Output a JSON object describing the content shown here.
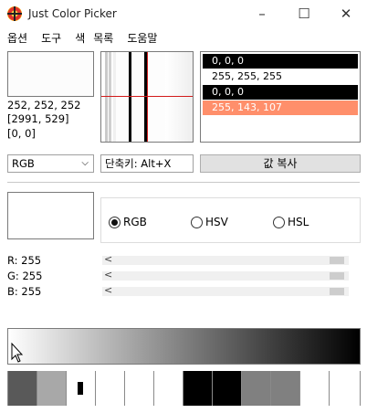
{
  "window": {
    "title": "Just Color Picker",
    "minimize": "–",
    "maximize": "☐",
    "close": "✕"
  },
  "menu": [
    "옵션",
    "도구",
    "색",
    "목록",
    "도움말"
  ],
  "info": {
    "rgb": "252, 252, 252",
    "coords": "[2991, 529]",
    "extra": "[0, 0]"
  },
  "history": [
    {
      "text": "0, 0, 0",
      "bg": "#000000",
      "fg": "#ffffff"
    },
    {
      "text": "255, 255, 255",
      "bg": "#ffffff",
      "fg": "#000000"
    },
    {
      "text": "0, 0, 0",
      "bg": "#000000",
      "fg": "#ffffff"
    },
    {
      "text": "255, 143, 107",
      "bg": "#ff8f6b",
      "fg": "#ffffff"
    }
  ],
  "format_select": "RGB",
  "hotkey": "단축키: Alt+X",
  "copy_button": "값 복사",
  "modes": [
    "RGB",
    "HSV",
    "HSL"
  ],
  "selected_mode": "RGB",
  "sliders": [
    {
      "label": "R: 255",
      "value": 255
    },
    {
      "label": "G: 255",
      "value": 255
    },
    {
      "label": "B: 255",
      "value": 255
    }
  ],
  "current_color": "#ffffff",
  "swatches": [
    "#595959",
    "#a8a8a8",
    "#ffffff",
    "#ffffff",
    "#ffffff",
    "#ffffff",
    "#000000",
    "#000000",
    "#808080",
    "#808080",
    "#ffffff",
    "#ffffff"
  ]
}
